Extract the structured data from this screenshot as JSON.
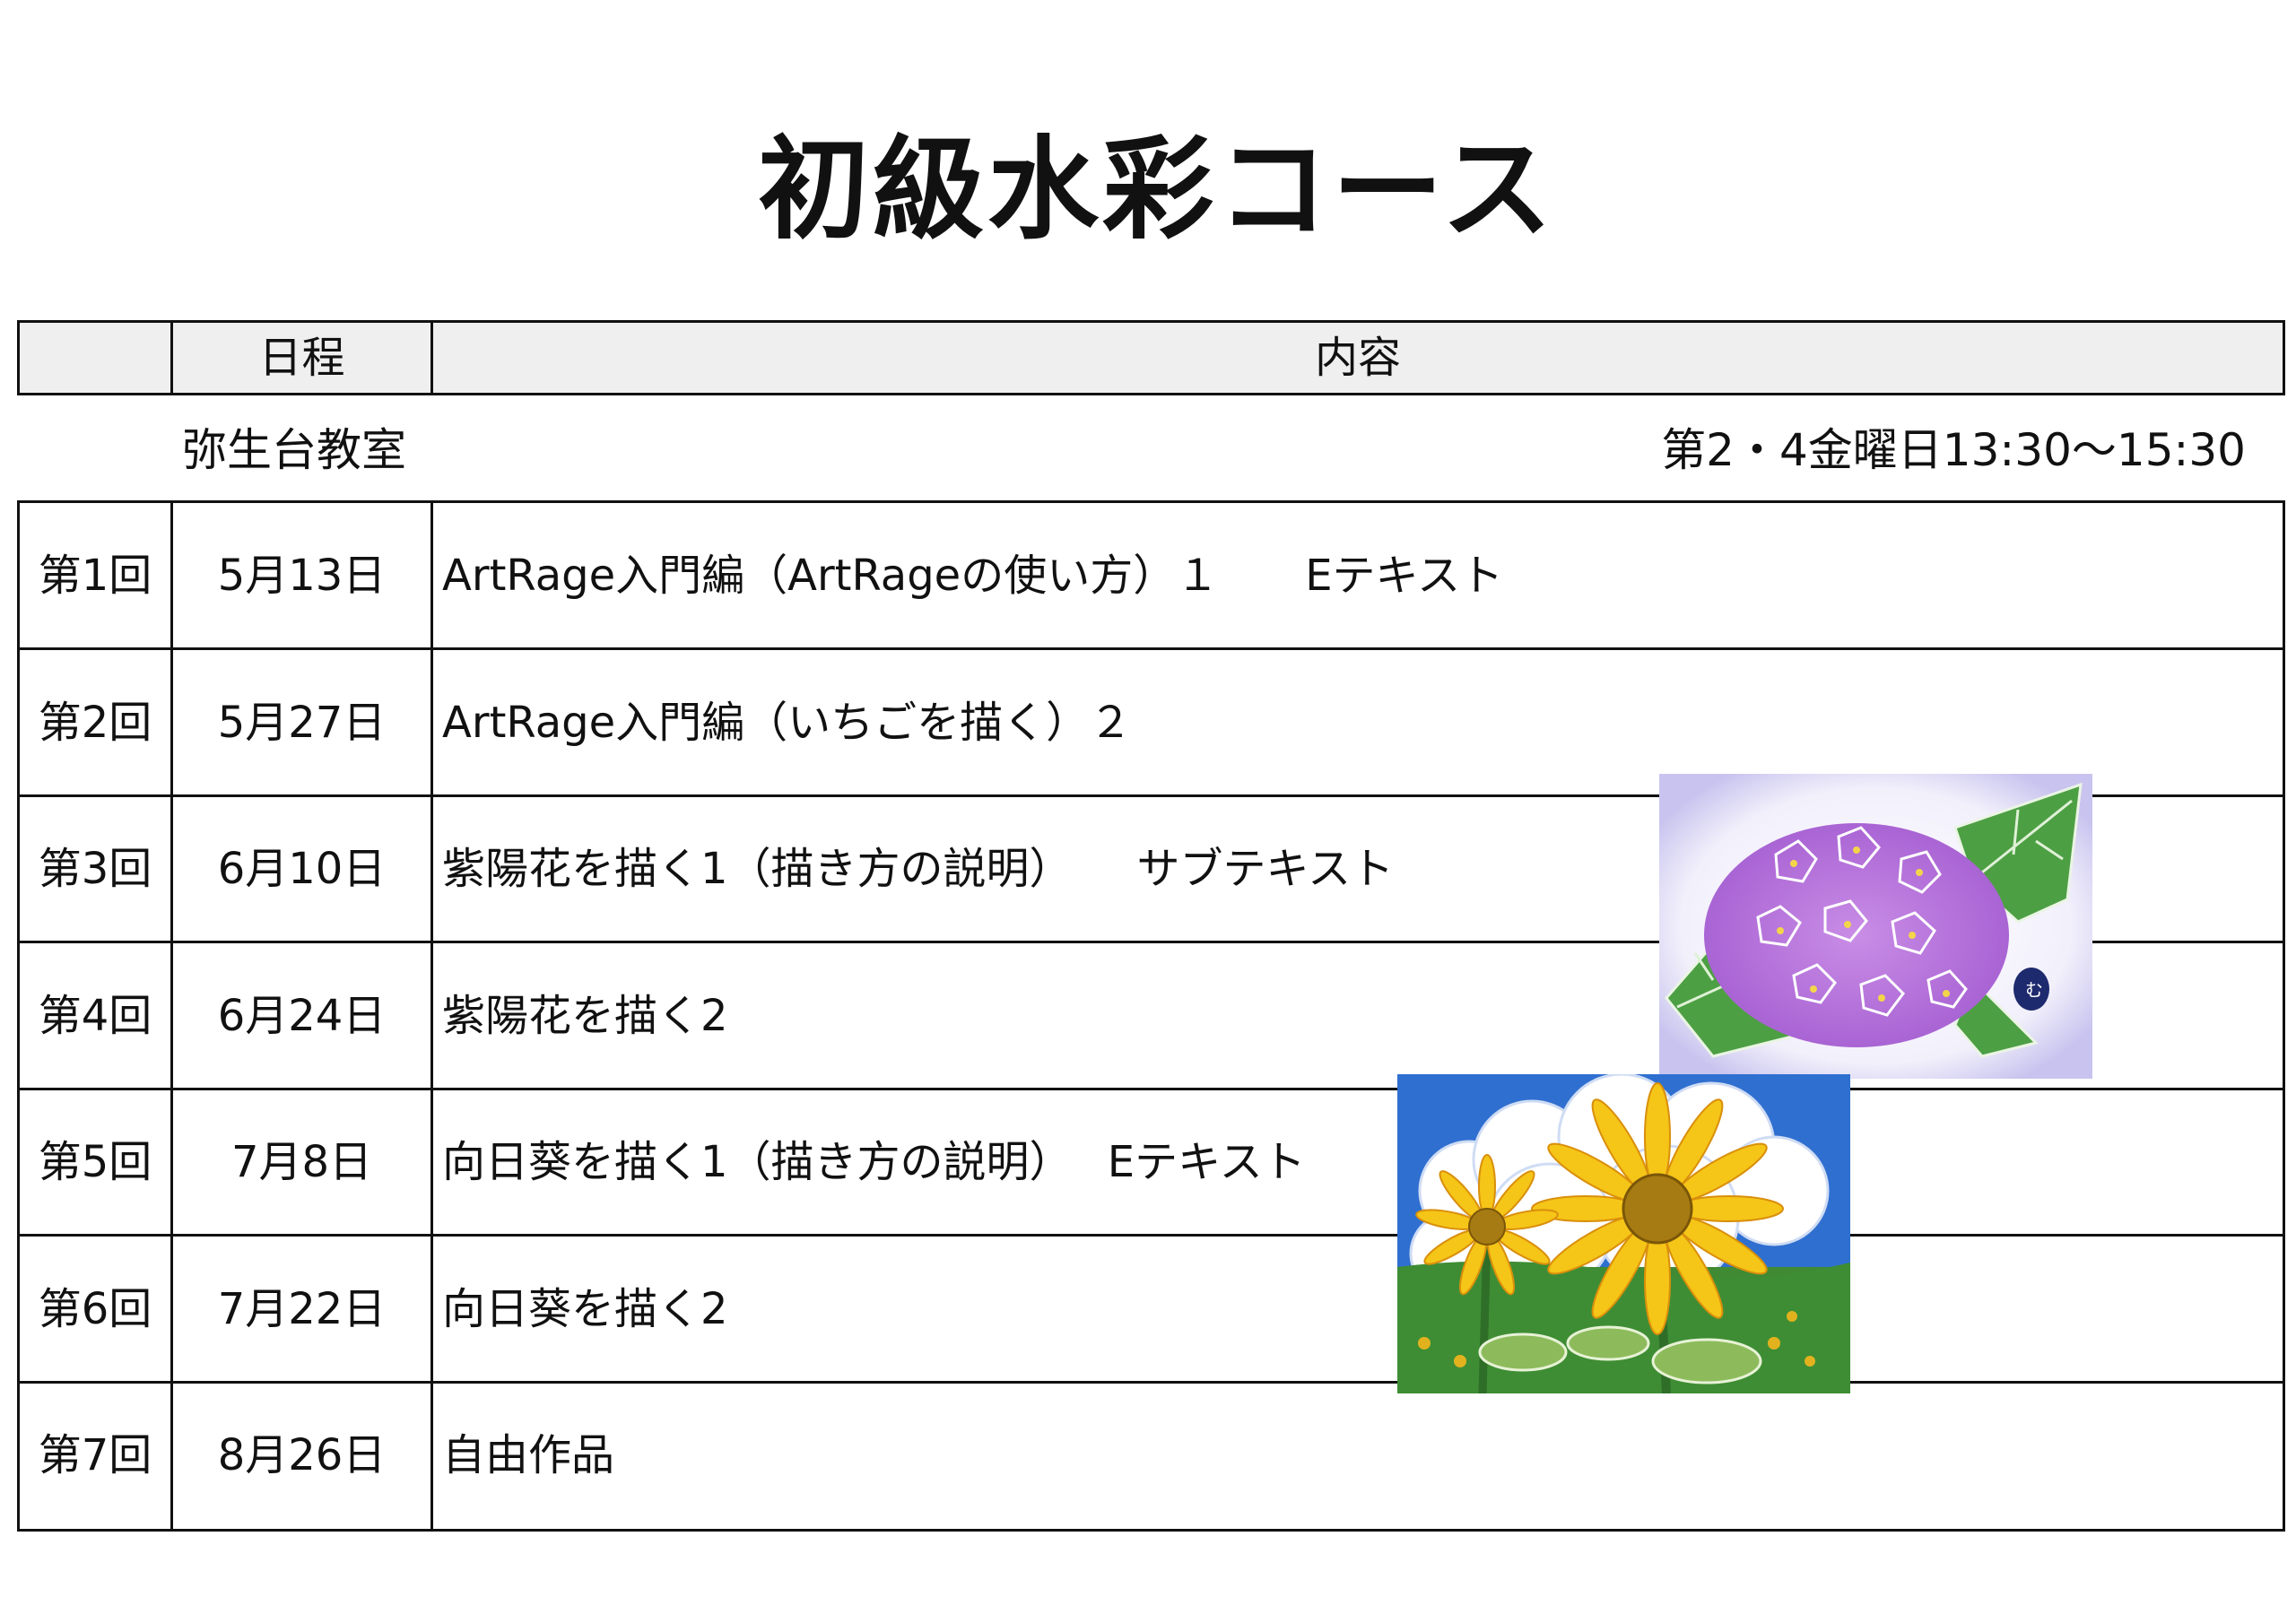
{
  "title": "初級水彩コース",
  "header": {
    "col_schedule": "日程",
    "col_content": "内容"
  },
  "location": "弥生台教室",
  "time_info": "第2・4金曜日13:30～15:30",
  "sessions": [
    {
      "no": "第1回",
      "date": "5月13日",
      "content": "ArtRage入門編（ArtRageの使い方）１　　Eテキスト"
    },
    {
      "no": "第2回",
      "date": "5月27日",
      "content": "ArtRage入門編（いちごを描く）２"
    },
    {
      "no": "第3回",
      "date": "6月10日",
      "content": "紫陽花を描く1（描き方の説明）　　サブテキスト"
    },
    {
      "no": "第4回",
      "date": "6月24日",
      "content": "紫陽花を描く2"
    },
    {
      "no": "第5回",
      "date": "7月8日",
      "content": "向日葵を描く1（描き方の説明）　 Eテキスト"
    },
    {
      "no": "第6回",
      "date": "7月22日",
      "content": "向日葵を描く2"
    },
    {
      "no": "第7回",
      "date": "8月26日",
      "content": "自由作品"
    }
  ],
  "colors": {
    "line": "#111111",
    "header_bg": "#efefef",
    "sky": "#2f6fd0",
    "petal": "#f5c518",
    "hydrangea": "#b06fd8",
    "leaf": "#3f9a3a"
  }
}
